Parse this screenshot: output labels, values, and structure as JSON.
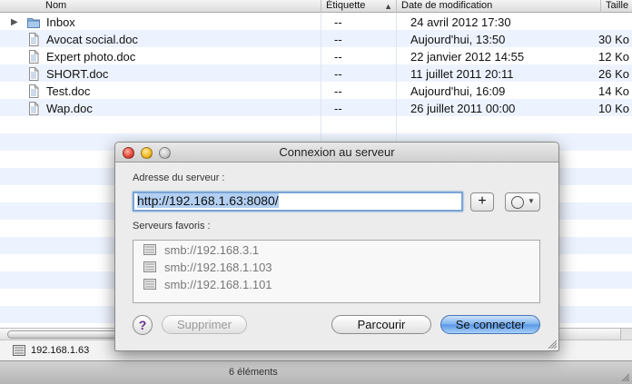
{
  "finder": {
    "columns": {
      "name": "Nom",
      "label": "Étiquette",
      "date": "Date de modification",
      "size": "Taille"
    },
    "rows": [
      {
        "name": "Inbox",
        "label": "--",
        "date": "24 avril 2012 17:30",
        "size": "",
        "icon": "folder-icon",
        "expandable": true
      },
      {
        "name": "Avocat social.doc",
        "label": "--",
        "date": "Aujourd'hui, 13:50",
        "size": "30 Ko",
        "icon": "document-icon"
      },
      {
        "name": "Expert photo.doc",
        "label": "--",
        "date": "22 janvier 2012 14:55",
        "size": "12 Ko",
        "icon": "document-icon"
      },
      {
        "name": "SHORT.doc",
        "label": "--",
        "date": "11 juillet 2011 20:11",
        "size": "26 Ko",
        "icon": "document-icon"
      },
      {
        "name": "Test.doc",
        "label": "--",
        "date": "Aujourd'hui, 16:09",
        "size": "14 Ko",
        "icon": "document-icon"
      },
      {
        "name": "Wap.doc",
        "label": "--",
        "date": "26 juillet 2011 00:00",
        "size": "10 Ko",
        "icon": "document-icon"
      }
    ],
    "path": "192.168.1.63",
    "status": "6 éléments"
  },
  "dialog": {
    "title": "Connexion au serveur",
    "address_label": "Adresse du serveur :",
    "address_value": "http://192.168.1.63:8080/",
    "add_label": "+",
    "favorites_label": "Serveurs favoris :",
    "favorites": [
      "smb://192.168.3.1",
      "smb://192.168.1.103",
      "smb://192.168.1.101"
    ],
    "help_label": "?",
    "remove_label": "Supprimer",
    "browse_label": "Parcourir",
    "connect_label": "Se connecter"
  }
}
